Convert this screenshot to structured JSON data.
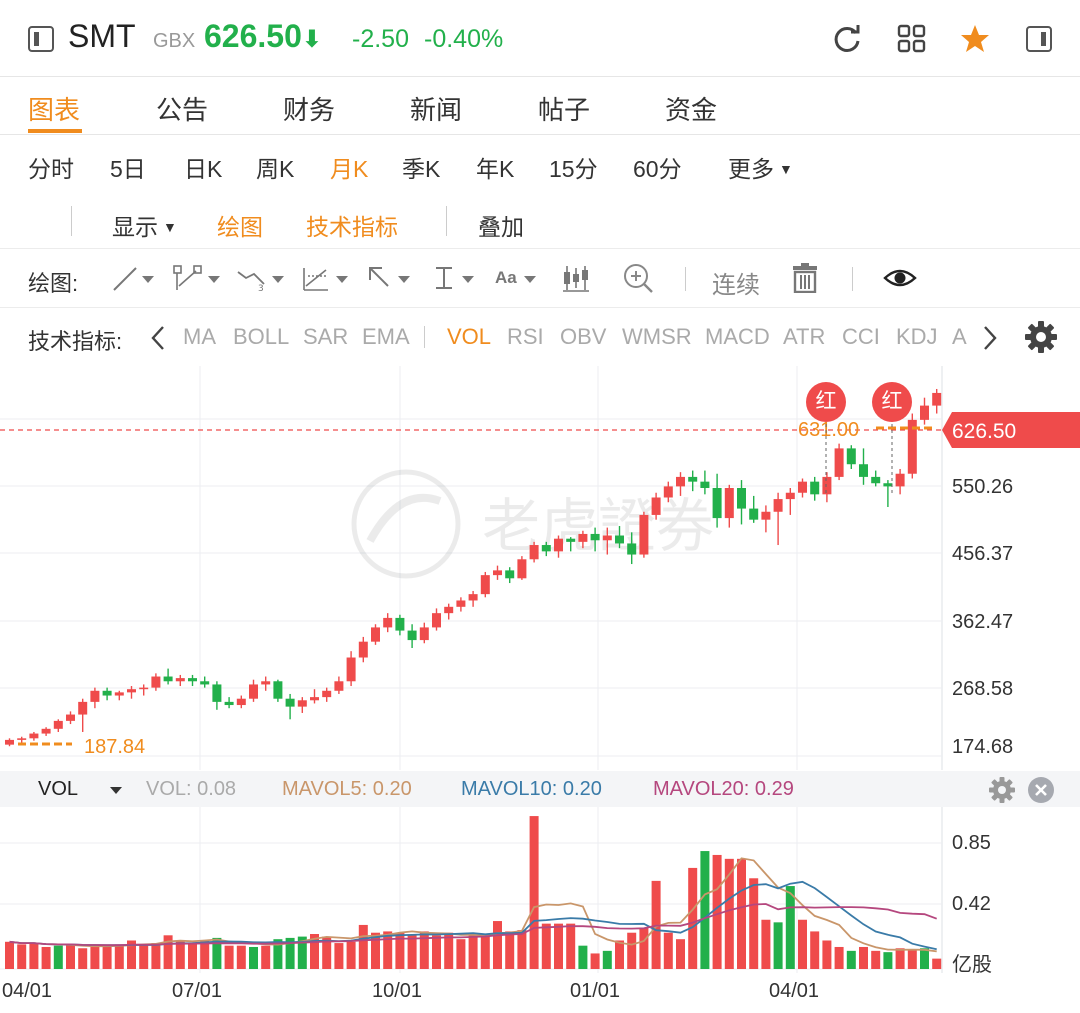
{
  "header": {
    "symbol": "SMT",
    "currency": "GBX",
    "price": "626.50",
    "arrow": "⬇",
    "change": "-2.50",
    "change_pct": "-0.40%"
  },
  "tabs": [
    {
      "label": "图表"
    },
    {
      "label": "公告"
    },
    {
      "label": "财务"
    },
    {
      "label": "新闻"
    },
    {
      "label": "帖子"
    },
    {
      "label": "资金"
    }
  ],
  "periods": [
    {
      "label": "分时"
    },
    {
      "label": "5日"
    },
    {
      "label": "日K"
    },
    {
      "label": "周K"
    },
    {
      "label": "月K"
    },
    {
      "label": "季K"
    },
    {
      "label": "年K"
    },
    {
      "label": "15分"
    },
    {
      "label": "60分"
    },
    {
      "label": "更多"
    }
  ],
  "toolbar2": {
    "display": "显示",
    "drawing": "绘图",
    "indicators": "技术指标",
    "overlay": "叠加"
  },
  "draw_row": {
    "label": "绘图:",
    "aa": "Aa",
    "continuous": "连续"
  },
  "indicators_row": {
    "label": "技术指标:",
    "items": [
      "MA",
      "BOLL",
      "SAR",
      "EMA",
      "VOL",
      "RSI",
      "OBV",
      "WMSR",
      "MACD",
      "ATR",
      "CCI",
      "KDJ",
      "A"
    ]
  },
  "price_axis": [
    "626.50",
    "550.26",
    "456.37",
    "362.47",
    "268.58",
    "174.68"
  ],
  "watermark": "老虎證券",
  "annotations": {
    "high": "631.00",
    "low": "187.84",
    "tag": "红"
  },
  "vol_legend": {
    "label": "VOL",
    "vol": "VOL: 0.08",
    "mavol5": "MAVOL5: 0.20",
    "mavol10": "MAVOL10: 0.20",
    "mavol20": "MAVOL20: 0.29"
  },
  "vol_axis": [
    "0.85",
    "0.42",
    "亿股"
  ],
  "x_axis": [
    "04/01",
    "07/01",
    "10/01",
    "01/01",
    "04/01"
  ],
  "colors": {
    "up": "#ef4b4b",
    "down": "#22b04b",
    "accent": "#f08c1e",
    "mavol5": "#c9966a",
    "mavol10": "#3a7ba8",
    "mavol20": "#b5477e"
  },
  "chart_data": {
    "type": "candlestick",
    "ohlc": [
      [
        182,
        190,
        180,
        188
      ],
      [
        188,
        192,
        184,
        190
      ],
      [
        190,
        198,
        187,
        196
      ],
      [
        196,
        204,
        193,
        202
      ],
      [
        202,
        214,
        198,
        212
      ],
      [
        212,
        224,
        208,
        220
      ],
      [
        220,
        240,
        198,
        236
      ],
      [
        236,
        254,
        228,
        250
      ],
      [
        250,
        254,
        238,
        244
      ],
      [
        244,
        250,
        238,
        248
      ],
      [
        248,
        256,
        240,
        252
      ],
      [
        252,
        258,
        244,
        254
      ],
      [
        254,
        272,
        250,
        268
      ],
      [
        268,
        278,
        258,
        262
      ],
      [
        262,
        270,
        256,
        266
      ],
      [
        266,
        270,
        256,
        262
      ],
      [
        262,
        268,
        254,
        258
      ],
      [
        258,
        262,
        226,
        236
      ],
      [
        236,
        242,
        228,
        232
      ],
      [
        232,
        244,
        228,
        240
      ],
      [
        240,
        264,
        236,
        258
      ],
      [
        258,
        268,
        250,
        262
      ],
      [
        262,
        264,
        236,
        240
      ],
      [
        240,
        246,
        214,
        230
      ],
      [
        230,
        242,
        222,
        238
      ],
      [
        238,
        252,
        234,
        242
      ],
      [
        242,
        254,
        236,
        250
      ],
      [
        250,
        268,
        246,
        262
      ],
      [
        262,
        300,
        256,
        292
      ],
      [
        292,
        318,
        286,
        312
      ],
      [
        312,
        334,
        308,
        330
      ],
      [
        330,
        348,
        324,
        342
      ],
      [
        342,
        346,
        320,
        326
      ],
      [
        326,
        334,
        304,
        314
      ],
      [
        314,
        336,
        310,
        330
      ],
      [
        330,
        354,
        326,
        348
      ],
      [
        348,
        360,
        340,
        356
      ],
      [
        356,
        368,
        350,
        364
      ],
      [
        364,
        376,
        356,
        372
      ],
      [
        372,
        400,
        368,
        396
      ],
      [
        396,
        408,
        390,
        402
      ],
      [
        402,
        406,
        386,
        392
      ],
      [
        392,
        420,
        390,
        416
      ],
      [
        416,
        438,
        412,
        434
      ],
      [
        434,
        438,
        420,
        426
      ],
      [
        426,
        446,
        418,
        442
      ],
      [
        442,
        444,
        426,
        438
      ],
      [
        438,
        452,
        430,
        448
      ],
      [
        448,
        456,
        426,
        440
      ],
      [
        440,
        456,
        422,
        446
      ],
      [
        446,
        458,
        430,
        436
      ],
      [
        436,
        450,
        410,
        422
      ],
      [
        422,
        476,
        418,
        472
      ],
      [
        472,
        500,
        466,
        494
      ],
      [
        494,
        514,
        488,
        508
      ],
      [
        508,
        526,
        496,
        520
      ],
      [
        520,
        528,
        502,
        514
      ],
      [
        514,
        528,
        498,
        506
      ],
      [
        506,
        524,
        456,
        468
      ],
      [
        468,
        510,
        456,
        506
      ],
      [
        506,
        516,
        460,
        480
      ],
      [
        480,
        496,
        462,
        466
      ],
      [
        466,
        484,
        450,
        476
      ],
      [
        476,
        500,
        434,
        492
      ],
      [
        492,
        506,
        472,
        500
      ],
      [
        500,
        518,
        494,
        514
      ],
      [
        514,
        520,
        490,
        498
      ],
      [
        498,
        526,
        488,
        520
      ],
      [
        520,
        562,
        516,
        556
      ],
      [
        556,
        560,
        530,
        536
      ],
      [
        536,
        556,
        510,
        520
      ],
      [
        520,
        528,
        508,
        512
      ],
      [
        512,
        516,
        482,
        508
      ],
      [
        508,
        530,
        498,
        524
      ],
      [
        524,
        600,
        518,
        592
      ],
      [
        592,
        620,
        586,
        610
      ],
      [
        610,
        631,
        600,
        626
      ]
    ],
    "volume": [
      [
        0.21,
        1
      ],
      [
        0.19,
        1
      ],
      [
        0.2,
        1
      ],
      [
        0.17,
        1
      ],
      [
        0.18,
        0
      ],
      [
        0.19,
        1
      ],
      [
        0.16,
        1
      ],
      [
        0.18,
        1
      ],
      [
        0.17,
        1
      ],
      [
        0.19,
        1
      ],
      [
        0.22,
        1
      ],
      [
        0.19,
        1
      ],
      [
        0.2,
        1
      ],
      [
        0.26,
        1
      ],
      [
        0.22,
        1
      ],
      [
        0.2,
        1
      ],
      [
        0.22,
        1
      ],
      [
        0.24,
        0
      ],
      [
        0.18,
        1
      ],
      [
        0.18,
        1
      ],
      [
        0.17,
        0
      ],
      [
        0.18,
        1
      ],
      [
        0.23,
        0
      ],
      [
        0.24,
        0
      ],
      [
        0.25,
        0
      ],
      [
        0.27,
        1
      ],
      [
        0.25,
        1
      ],
      [
        0.2,
        1
      ],
      [
        0.21,
        1
      ],
      [
        0.34,
        1
      ],
      [
        0.28,
        1
      ],
      [
        0.29,
        1
      ],
      [
        0.28,
        1
      ],
      [
        0.26,
        1
      ],
      [
        0.29,
        1
      ],
      [
        0.26,
        1
      ],
      [
        0.28,
        1
      ],
      [
        0.23,
        1
      ],
      [
        0.26,
        1
      ],
      [
        0.25,
        1
      ],
      [
        0.37,
        1
      ],
      [
        0.29,
        1
      ],
      [
        0.3,
        1
      ],
      [
        1.18,
        1
      ],
      [
        0.35,
        1
      ],
      [
        0.35,
        1
      ],
      [
        0.35,
        1
      ],
      [
        0.18,
        0
      ],
      [
        0.12,
        1
      ],
      [
        0.14,
        0
      ],
      [
        0.22,
        1
      ],
      [
        0.28,
        1
      ],
      [
        0.32,
        1
      ],
      [
        0.68,
        1
      ],
      [
        0.28,
        1
      ],
      [
        0.23,
        1
      ],
      [
        0.78,
        1
      ],
      [
        0.91,
        0
      ],
      [
        0.88,
        1
      ],
      [
        0.85,
        1
      ],
      [
        0.85,
        1
      ],
      [
        0.7,
        1
      ],
      [
        0.38,
        1
      ],
      [
        0.36,
        0
      ],
      [
        0.64,
        0
      ],
      [
        0.38,
        1
      ],
      [
        0.29,
        1
      ],
      [
        0.22,
        1
      ],
      [
        0.17,
        1
      ],
      [
        0.14,
        0
      ],
      [
        0.17,
        1
      ],
      [
        0.14,
        1
      ],
      [
        0.13,
        0
      ],
      [
        0.16,
        1
      ],
      [
        0.15,
        1
      ],
      [
        0.16,
        0
      ],
      [
        0.08,
        1
      ]
    ],
    "mavol5_end": 0.2,
    "mavol10_end": 0.2,
    "mavol20_end": 0.29,
    "price_range": [
      150,
      660
    ],
    "volume_range": [
      0,
      1.25
    ]
  }
}
